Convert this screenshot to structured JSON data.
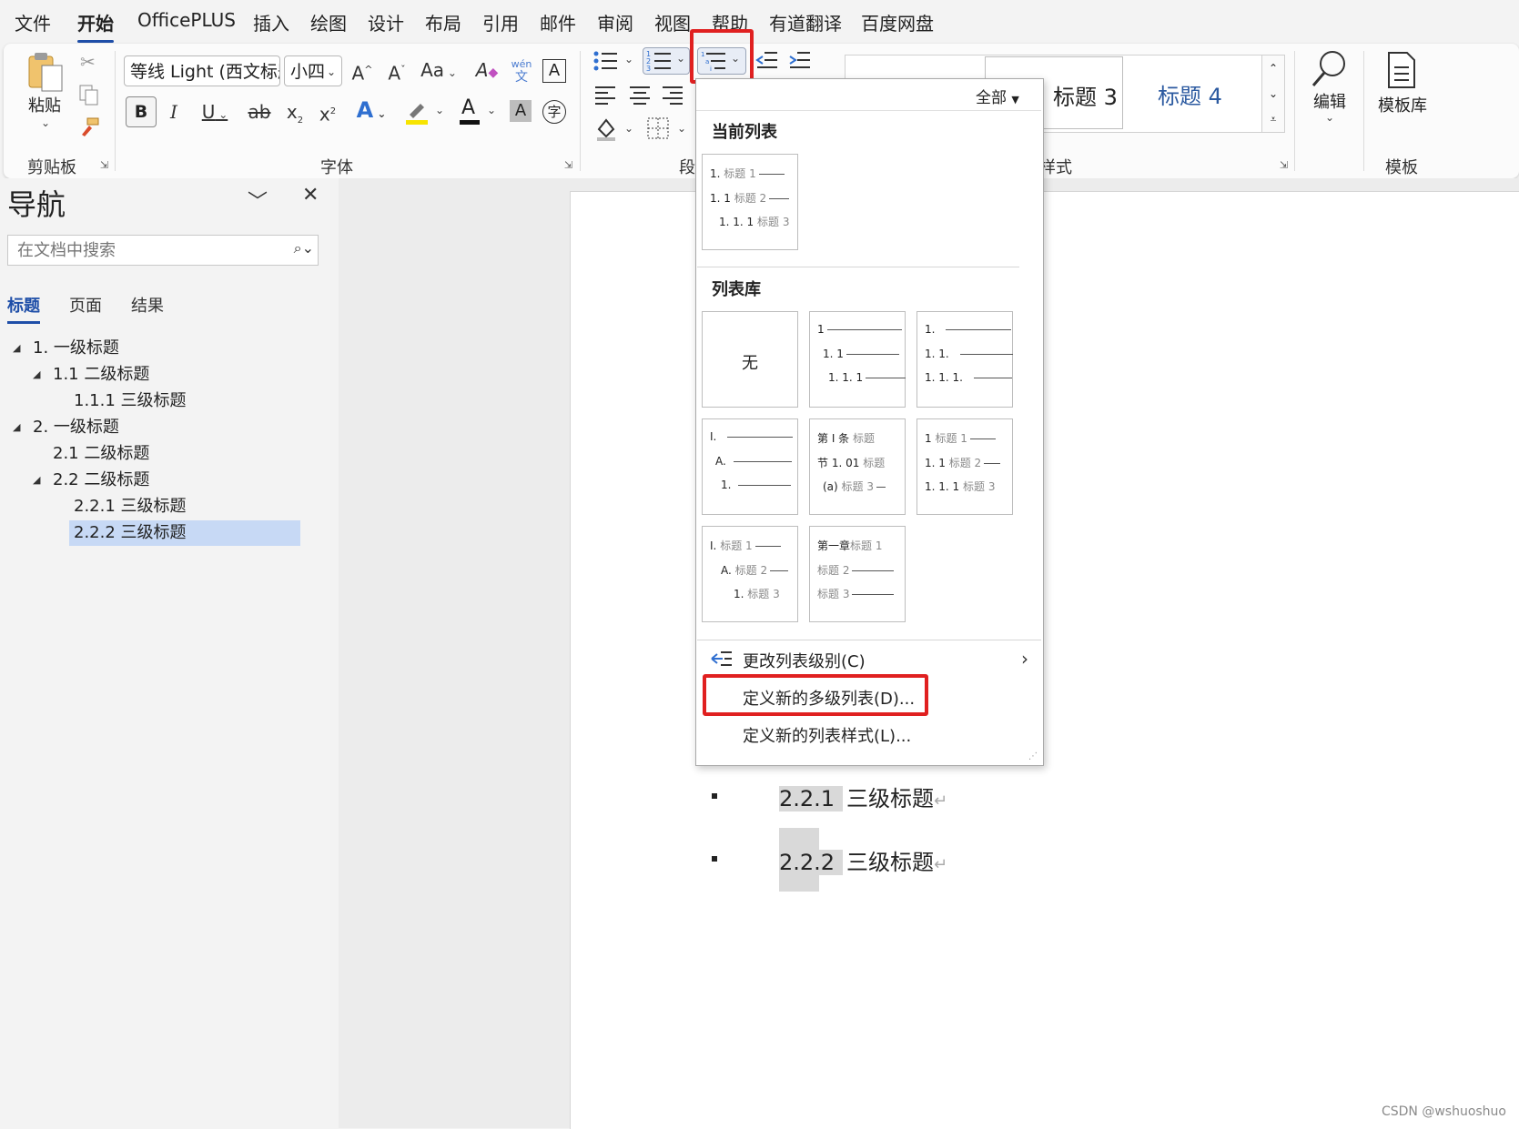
{
  "menubar": {
    "items": [
      "文件",
      "开始",
      "OfficePLUS",
      "插入",
      "绘图",
      "设计",
      "布局",
      "引用",
      "邮件",
      "审阅",
      "视图",
      "帮助",
      "有道翻译",
      "百度网盘"
    ],
    "active": "开始"
  },
  "ribbon": {
    "clipboard": {
      "paste_label": "粘贴",
      "group_label": "剪贴板"
    },
    "font": {
      "font_name": "等线 Light (西文标题",
      "font_size": "小四",
      "grow": "A",
      "shrink": "A",
      "change_case": "Aa",
      "bold": "B",
      "italic": "I",
      "underline": "U",
      "strike": "ab",
      "subscript": "x",
      "superscript": "x",
      "font_color": "A",
      "char_shading": "A",
      "char_border": "A",
      "enclose": "字",
      "phonetic_top": "wén",
      "phonetic_bottom": "文",
      "group_label": "字体"
    },
    "paragraph": {
      "group_label": "段"
    },
    "styles": {
      "items": [
        "标题 3",
        "标题 4"
      ],
      "group_label": "样式",
      "label_partial": "样式"
    },
    "editing": {
      "label": "编辑"
    },
    "templates": {
      "button_label": "模板库",
      "group_label": "模板"
    }
  },
  "nav": {
    "title": "导航",
    "search_placeholder": "在文档中搜索",
    "tabs": [
      "标题",
      "页面",
      "结果"
    ],
    "active_tab": "标题",
    "tree": [
      {
        "label": "1. 一级标题",
        "level": 1,
        "expanded": true
      },
      {
        "label": "1.1 二级标题",
        "level": 2,
        "expanded": true
      },
      {
        "label": "1.1.1 三级标题",
        "level": 3
      },
      {
        "label": "2. 一级标题",
        "level": 1,
        "expanded": true
      },
      {
        "label": "2.1 二级标题",
        "level": 2
      },
      {
        "label": "2.2 二级标题",
        "level": 2,
        "expanded": true
      },
      {
        "label": "2.2.1 三级标题",
        "level": 3
      },
      {
        "label": "2.2.2 三级标题",
        "level": 3,
        "selected": true
      }
    ]
  },
  "document": {
    "lines": [
      {
        "number": "2.2.1",
        "text": "三级标题",
        "mark": "↵"
      },
      {
        "number": "2.2.2",
        "text": "三级标题",
        "mark": "↵"
      }
    ]
  },
  "dropdown": {
    "filter": "全部",
    "current_list_heading": "当前列表",
    "current_list": {
      "lines": [
        {
          "num": "1.",
          "label": "标题 1"
        },
        {
          "num": "1. 1",
          "label": "标题 2"
        },
        {
          "num": "1. 1. 1",
          "label": "标题 3"
        }
      ]
    },
    "library_heading": "列表库",
    "library": {
      "none_label": "无",
      "t2": [
        "1",
        "1. 1",
        "1. 1. 1"
      ],
      "t3": [
        "1.",
        "1. 1.",
        "1. 1. 1."
      ],
      "t4": [
        "I.",
        "A.",
        "1."
      ],
      "t5": [
        {
          "num": "第 Ⅰ 条",
          "label": "标题"
        },
        {
          "num": "节 1. 01",
          "label": "标题"
        },
        {
          "num": "(a)",
          "label": "标题 3"
        }
      ],
      "t6": [
        {
          "num": "1",
          "label": "标题 1"
        },
        {
          "num": "1. 1",
          "label": "标题 2"
        },
        {
          "num": "1. 1. 1",
          "label": "标题 3"
        }
      ],
      "t7": [
        {
          "num": "I.",
          "label": "标题 1"
        },
        {
          "num": "A.",
          "label": "标题 2"
        },
        {
          "num": "1.",
          "label": "标题 3"
        }
      ],
      "t8": [
        {
          "num": "第一章",
          "label": "标题 1"
        },
        {
          "num": "",
          "label": "标题 2"
        },
        {
          "num": "",
          "label": "标题 3"
        }
      ]
    },
    "actions": {
      "change_level": "更改列表级别(C)",
      "define_new_multilevel": "定义新的多级列表(D)...",
      "define_new_style": "定义新的列表样式(L)..."
    }
  },
  "highlight_color": "#e02020",
  "accent_color": "#1e4ea8",
  "watermark": "CSDN @wshuoshuo"
}
